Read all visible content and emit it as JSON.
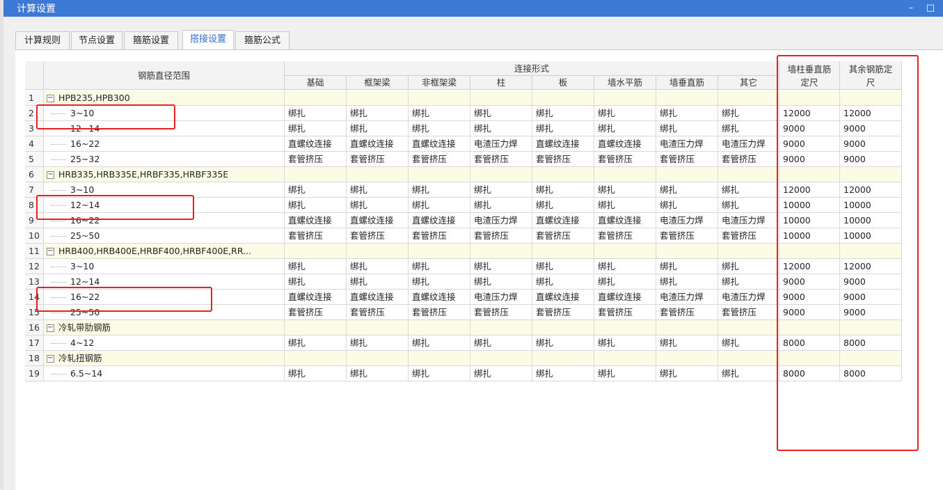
{
  "window": {
    "title": "计算设置",
    "minimize": "–",
    "maximize": "□"
  },
  "tabs": [
    {
      "label": "计算规则"
    },
    {
      "label": "节点设置"
    },
    {
      "label": "箍筋设置"
    },
    {
      "label": "搭接设置",
      "active": true
    },
    {
      "label": "箍筋公式"
    }
  ],
  "table": {
    "header": {
      "range": "钢筋直径范围",
      "connection_group": "连接形式",
      "columns": [
        "基础",
        "框架梁",
        "非框架梁",
        "柱",
        "板",
        "墙水平筋",
        "墙垂直筋",
        "其它"
      ],
      "wall_length_1": "墙柱垂直筋",
      "wall_length_2": "定尺",
      "other_length_1": "其余钢筋定",
      "other_length_2": "尺"
    },
    "rows": [
      {
        "n": "1",
        "group": true,
        "label": "HPB235,HPB300"
      },
      {
        "n": "2",
        "label": "3~10",
        "c": [
          "绑扎",
          "绑扎",
          "绑扎",
          "绑扎",
          "绑扎",
          "绑扎",
          "绑扎",
          "绑扎"
        ],
        "w": "12000",
        "o": "12000"
      },
      {
        "n": "3",
        "label": "12~14",
        "c": [
          "绑扎",
          "绑扎",
          "绑扎",
          "绑扎",
          "绑扎",
          "绑扎",
          "绑扎",
          "绑扎"
        ],
        "w": "9000",
        "o": "9000"
      },
      {
        "n": "4",
        "label": "16~22",
        "c": [
          "直螺纹连接",
          "直螺纹连接",
          "直螺纹连接",
          "电渣压力焊",
          "直螺纹连接",
          "直螺纹连接",
          "电渣压力焊",
          "电渣压力焊"
        ],
        "w": "9000",
        "o": "9000"
      },
      {
        "n": "5",
        "label": "25~32",
        "c": [
          "套管挤压",
          "套管挤压",
          "套管挤压",
          "套管挤压",
          "套管挤压",
          "套管挤压",
          "套管挤压",
          "套管挤压"
        ],
        "w": "9000",
        "o": "9000"
      },
      {
        "n": "6",
        "group": true,
        "label": "HRB335,HRB335E,HRBF335,HRBF335E"
      },
      {
        "n": "7",
        "label": "3~10",
        "c": [
          "绑扎",
          "绑扎",
          "绑扎",
          "绑扎",
          "绑扎",
          "绑扎",
          "绑扎",
          "绑扎"
        ],
        "w": "12000",
        "o": "12000"
      },
      {
        "n": "8",
        "label": "12~14",
        "c": [
          "绑扎",
          "绑扎",
          "绑扎",
          "绑扎",
          "绑扎",
          "绑扎",
          "绑扎",
          "绑扎"
        ],
        "w": "10000",
        "o": "10000"
      },
      {
        "n": "9",
        "label": "16~22",
        "c": [
          "直螺纹连接",
          "直螺纹连接",
          "直螺纹连接",
          "电渣压力焊",
          "直螺纹连接",
          "直螺纹连接",
          "电渣压力焊",
          "电渣压力焊"
        ],
        "w": "10000",
        "o": "10000"
      },
      {
        "n": "10",
        "label": "25~50",
        "c": [
          "套管挤压",
          "套管挤压",
          "套管挤压",
          "套管挤压",
          "套管挤压",
          "套管挤压",
          "套管挤压",
          "套管挤压"
        ],
        "w": "10000",
        "o": "10000"
      },
      {
        "n": "11",
        "group": true,
        "label": "HRB400,HRB400E,HRBF400,HRBF400E,RR..."
      },
      {
        "n": "12",
        "label": "3~10",
        "c": [
          "绑扎",
          "绑扎",
          "绑扎",
          "绑扎",
          "绑扎",
          "绑扎",
          "绑扎",
          "绑扎"
        ],
        "w": "12000",
        "o": "12000"
      },
      {
        "n": "13",
        "label": "12~14",
        "c": [
          "绑扎",
          "绑扎",
          "绑扎",
          "绑扎",
          "绑扎",
          "绑扎",
          "绑扎",
          "绑扎"
        ],
        "w": "9000",
        "o": "9000"
      },
      {
        "n": "14",
        "label": "16~22",
        "c": [
          "直螺纹连接",
          "直螺纹连接",
          "直螺纹连接",
          "电渣压力焊",
          "直螺纹连接",
          "直螺纹连接",
          "电渣压力焊",
          "电渣压力焊"
        ],
        "w": "9000",
        "o": "9000"
      },
      {
        "n": "15",
        "label": "25~50",
        "c": [
          "套管挤压",
          "套管挤压",
          "套管挤压",
          "套管挤压",
          "套管挤压",
          "套管挤压",
          "套管挤压",
          "套管挤压"
        ],
        "w": "9000",
        "o": "9000"
      },
      {
        "n": "16",
        "group": true,
        "label": "冷轧带肋钢筋"
      },
      {
        "n": "17",
        "label": "4~12",
        "c": [
          "绑扎",
          "绑扎",
          "绑扎",
          "绑扎",
          "绑扎",
          "绑扎",
          "绑扎",
          "绑扎"
        ],
        "w": "8000",
        "o": "8000"
      },
      {
        "n": "18",
        "group": true,
        "label": "冷轧扭钢筋"
      },
      {
        "n": "19",
        "label": "6.5~14",
        "c": [
          "绑扎",
          "绑扎",
          "绑扎",
          "绑扎",
          "绑扎",
          "绑扎",
          "绑扎",
          "绑扎"
        ],
        "w": "8000",
        "o": "8000"
      }
    ]
  },
  "colors": {
    "titlebar": "#3c7ad6",
    "group_row": "#fbfbe6",
    "highlight": "#e8201e",
    "active_tab_text": "#2a6fd6"
  }
}
